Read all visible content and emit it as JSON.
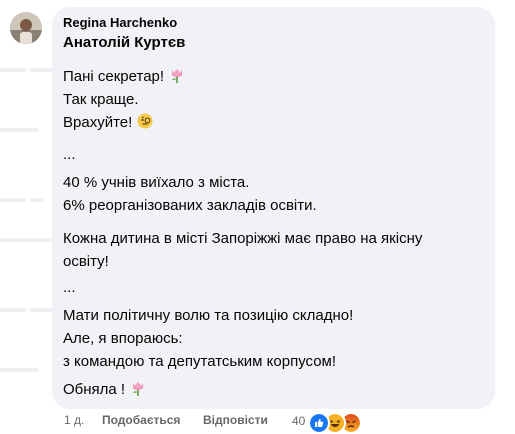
{
  "comment": {
    "author": "Regina Harchenko",
    "mention": "Анатолій Куртєв",
    "lines": [
      "Пані секретар!",
      "Так краще.",
      "Врахуйте!",
      "...",
      "40 % учнів виїхало з міста.",
      "6% реорганізованих закладів освіти.",
      "Кожна дитина в місті Запоріжжі має право на якісну",
      "освіту!",
      "...",
      "Мати політичну волю та позицію складно!",
      "Але, я впораюсь:",
      "з командою та депутатським корпусом!",
      "Обняла !"
    ],
    "emojis": {
      "line0": "tulip-emoji",
      "line2": "monocle-face-emoji",
      "line12": "tulip-emoji"
    }
  },
  "meta": {
    "time": "1 д.",
    "like_label": "Подобається",
    "reply_label": "Відповісти"
  },
  "reactions": {
    "count": "40",
    "icons": [
      "like-icon",
      "haha-icon",
      "angry-icon"
    ],
    "colors": {
      "like": "#1877f2",
      "haha": "#f7b125",
      "angry": "#e9710f"
    }
  }
}
